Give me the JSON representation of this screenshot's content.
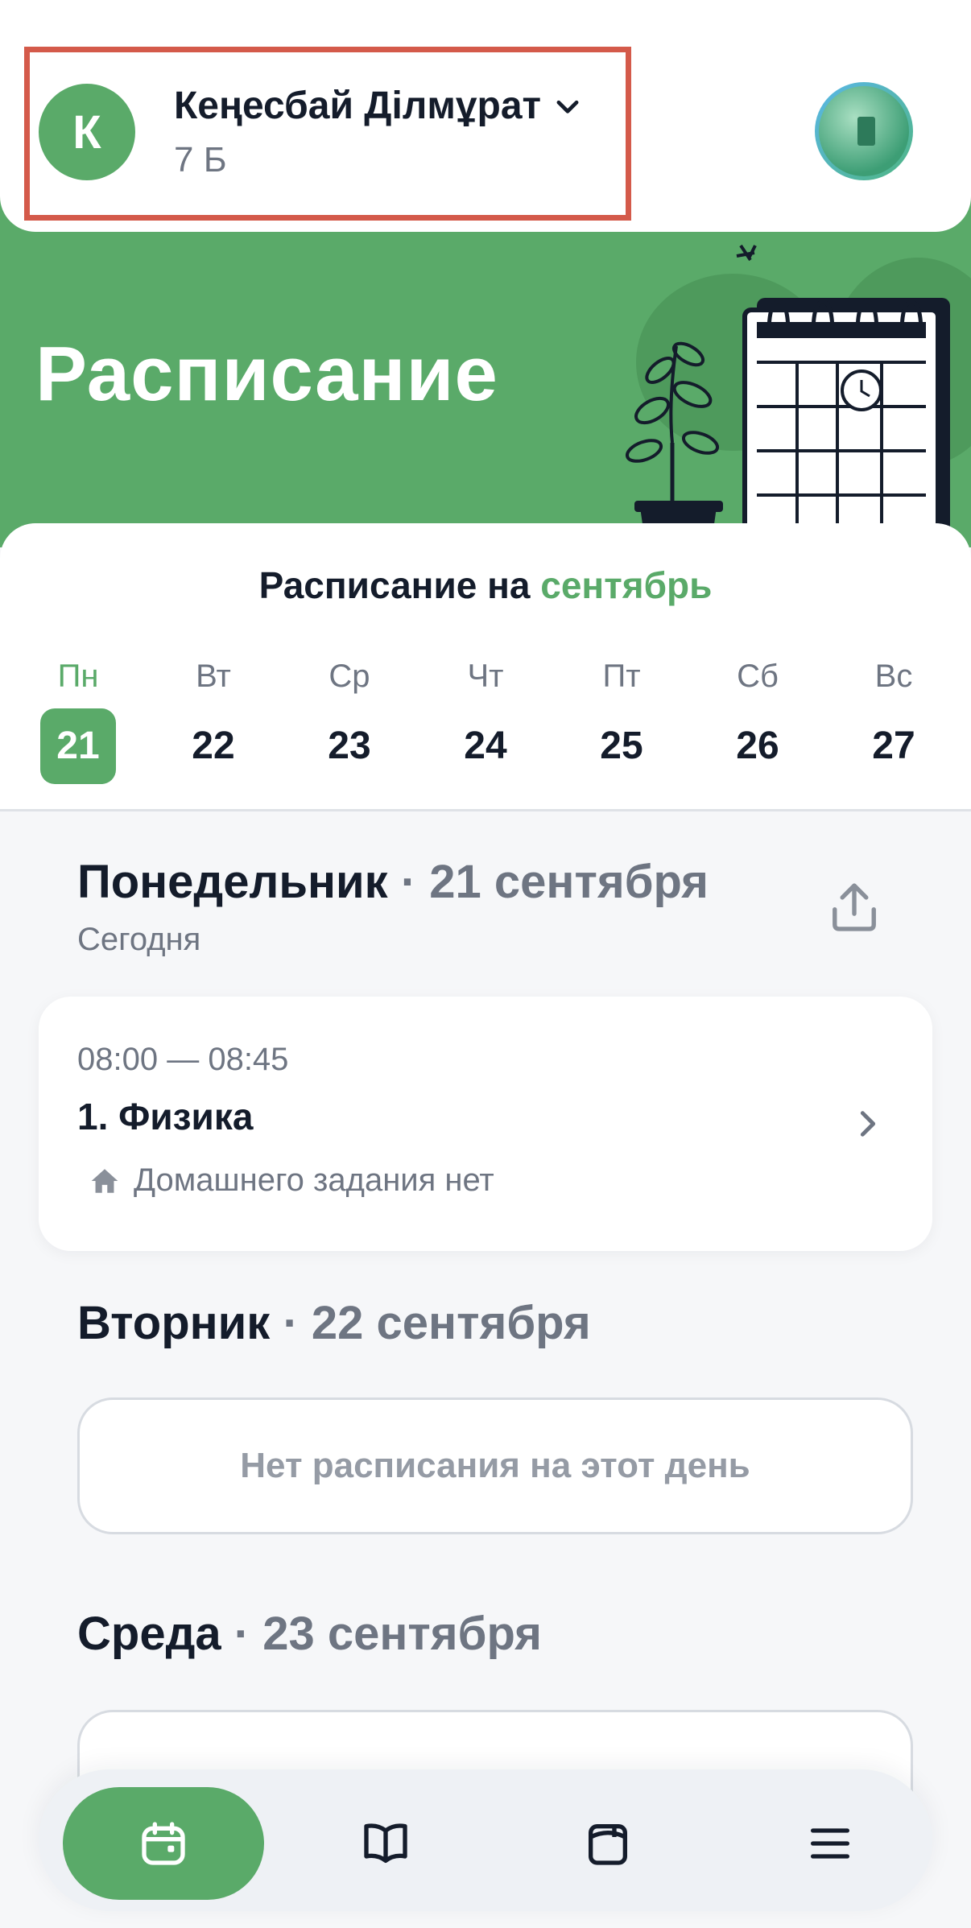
{
  "header": {
    "avatar_letter": "К",
    "user_name": "Кеңесбай Ділмұрат",
    "user_class": "7 Б"
  },
  "banner": {
    "title": "Расписание"
  },
  "calendar": {
    "heading_prefix": "Расписание на",
    "heading_month": "сентябрь",
    "days": [
      {
        "name": "Пн",
        "num": "21",
        "active": true
      },
      {
        "name": "Вт",
        "num": "22"
      },
      {
        "name": "Ср",
        "num": "23"
      },
      {
        "name": "Чт",
        "num": "24"
      },
      {
        "name": "Пт",
        "num": "25"
      },
      {
        "name": "Сб",
        "num": "26"
      },
      {
        "name": "Вс",
        "num": "27"
      }
    ]
  },
  "monday": {
    "weekday": "Понедельник",
    "date": "21 сентября",
    "subtitle": "Сегодня",
    "lesson": {
      "time": "08:00 — 08:45",
      "name": "1. Физика",
      "homework": "Домашнего задания нет"
    }
  },
  "tuesday": {
    "weekday": "Вторник",
    "date": "22 сентября",
    "empty": "Нет расписания на этот день"
  },
  "wednesday": {
    "weekday": "Среда",
    "date": "23 сентября"
  },
  "nav": {
    "items": [
      "calendar-icon",
      "book-icon",
      "diary-icon",
      "menu-icon"
    ]
  },
  "colors": {
    "accent": "#5aaa69",
    "highlight_border": "#d45a4a"
  }
}
